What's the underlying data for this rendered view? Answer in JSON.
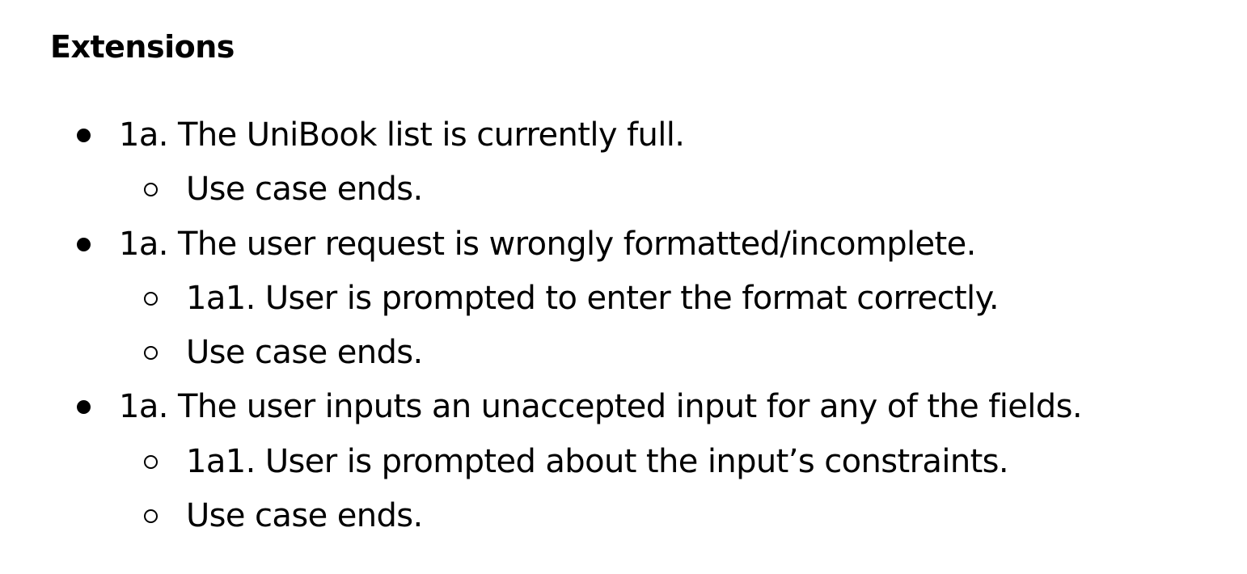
{
  "heading": "Extensions",
  "items": [
    {
      "text": "1a. The UniBook list is currently full.",
      "sub": [
        "Use case ends."
      ]
    },
    {
      "text": "1a. The user request is wrongly formatted/incomplete.",
      "sub": [
        "1a1. User is prompted to enter the format correctly.",
        "Use case ends."
      ]
    },
    {
      "text": "1a. The user inputs an unaccepted input for any of the fields.",
      "sub": [
        "1a1. User is prompted about the input’s constraints.",
        "Use case ends."
      ]
    }
  ]
}
